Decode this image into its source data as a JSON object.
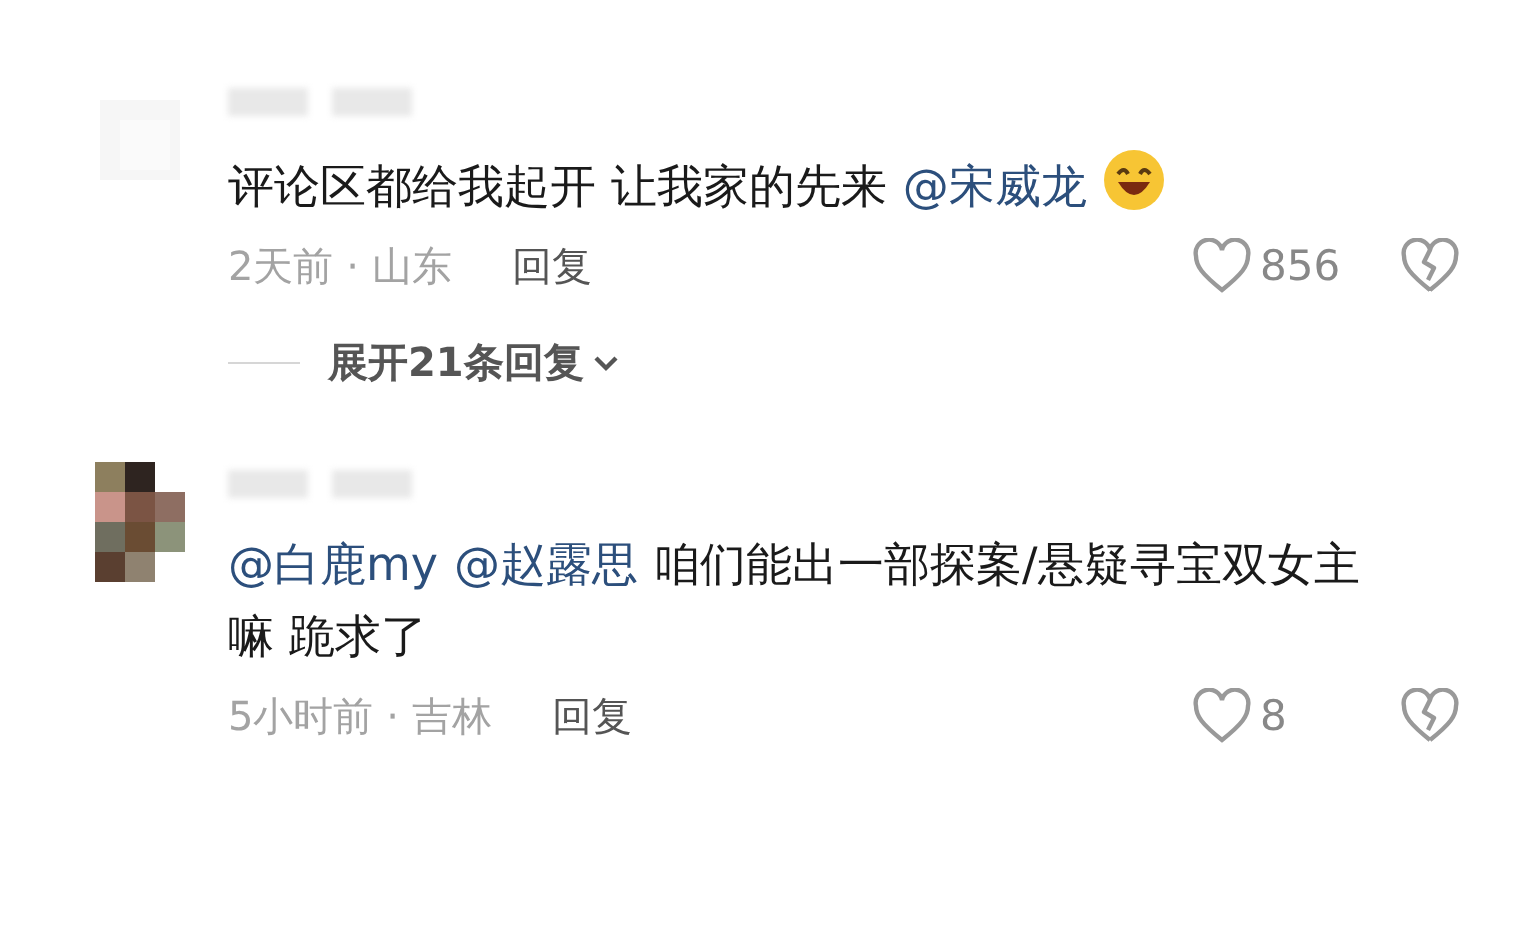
{
  "comments": [
    {
      "parts": [
        {
          "kind": "text",
          "text": "评论区都给我起开 让我家的先来"
        },
        {
          "kind": "mention",
          "text": "@宋威龙"
        },
        {
          "kind": "emoji"
        }
      ],
      "time": "2天前 · 山东",
      "reply": "回复",
      "likes": "856",
      "expand": "展开21条回复"
    },
    {
      "parts": [
        {
          "kind": "mention",
          "text": "@白鹿my"
        },
        {
          "kind": "mention",
          "text": "@赵露思"
        },
        {
          "kind": "text",
          "text": "咱们能出一部探案/悬疑寻宝双女主嘛 跪求了"
        }
      ],
      "time": "5小时前 · 吉林",
      "reply": "回复",
      "likes": "8"
    }
  ]
}
